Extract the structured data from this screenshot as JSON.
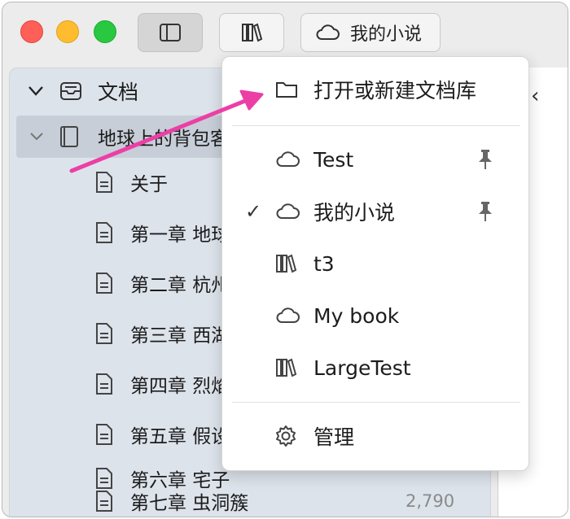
{
  "titlebar": {
    "current_library_label": "我的小说"
  },
  "sidebar": {
    "root_label": "文档",
    "book_label": "地球上的背包客",
    "docs": [
      {
        "label": "关于",
        "count": ""
      },
      {
        "label": "第一章 地球",
        "count": ""
      },
      {
        "label": "第二章 杭州",
        "count": ""
      },
      {
        "label": "第三章 西湖",
        "count": ""
      },
      {
        "label": "第四章 烈焰",
        "count": ""
      },
      {
        "label": "第五章 假设",
        "count": ""
      },
      {
        "label": "第六章 宅子",
        "count": ""
      },
      {
        "label": "第七章 虫洞簇",
        "count": "2,790"
      }
    ]
  },
  "menu": {
    "open_or_new_label": "打开或新建文档库",
    "libraries": [
      {
        "label": "Test",
        "icon": "cloud-icon",
        "pinned": true,
        "checked": false
      },
      {
        "label": "我的小说",
        "icon": "cloud-icon",
        "pinned": true,
        "checked": true
      },
      {
        "label": "t3",
        "icon": "library-icon",
        "pinned": false,
        "checked": false
      },
      {
        "label": "My book",
        "icon": "cloud-icon",
        "pinned": false,
        "checked": false
      },
      {
        "label": "LargeTest",
        "icon": "library-icon",
        "pinned": false,
        "checked": false
      }
    ],
    "manage_label": "管理",
    "check_mark": "✓"
  },
  "colors": {
    "annotation_arrow": "#ec3fa6",
    "sidebar_bg": "#dde3eb",
    "selected_row": "#c7ced8"
  }
}
